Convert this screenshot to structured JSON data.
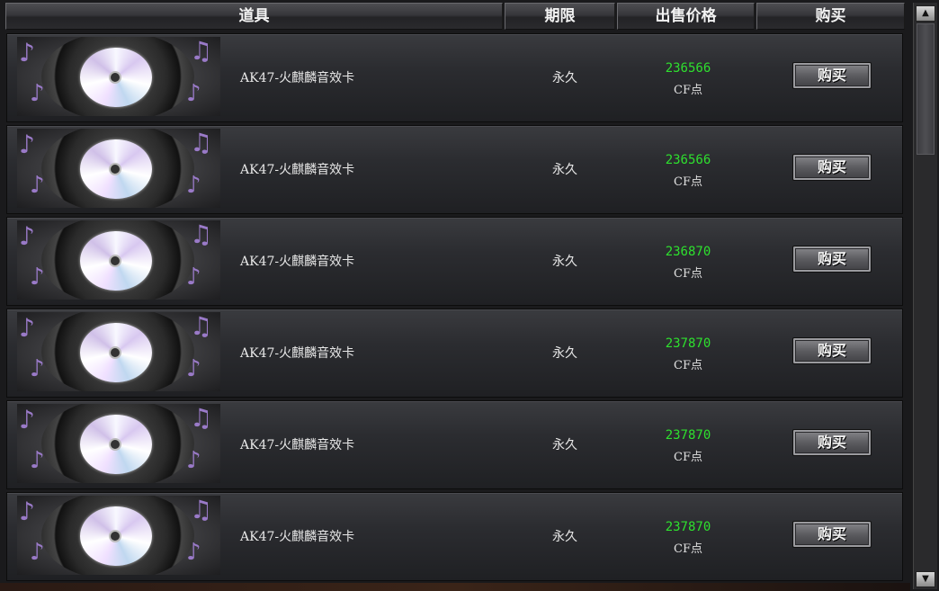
{
  "header": {
    "item": "道具",
    "term": "期限",
    "price": "出售价格",
    "buy": "购买"
  },
  "rows": [
    {
      "name": "AK47-火麒麟音效卡",
      "term": "永久",
      "price": "236566",
      "currency": "CF点",
      "buy_label": "购买"
    },
    {
      "name": "AK47-火麒麟音效卡",
      "term": "永久",
      "price": "236566",
      "currency": "CF点",
      "buy_label": "购买"
    },
    {
      "name": "AK47-火麒麟音效卡",
      "term": "永久",
      "price": "236870",
      "currency": "CF点",
      "buy_label": "购买"
    },
    {
      "name": "AK47-火麒麟音效卡",
      "term": "永久",
      "price": "237870",
      "currency": "CF点",
      "buy_label": "购买"
    },
    {
      "name": "AK47-火麒麟音效卡",
      "term": "永久",
      "price": "237870",
      "currency": "CF点",
      "buy_label": "购买"
    },
    {
      "name": "AK47-火麒麟音效卡",
      "term": "永久",
      "price": "237870",
      "currency": "CF点",
      "buy_label": "购买"
    }
  ],
  "icons": {
    "item_image": "music-disc-card-icon",
    "scroll_up": "arrow-up-icon",
    "scroll_down": "arrow-down-icon"
  },
  "colors": {
    "price": "#2ee02e",
    "text": "#e8e8e8",
    "background": "#1a1a1c"
  }
}
